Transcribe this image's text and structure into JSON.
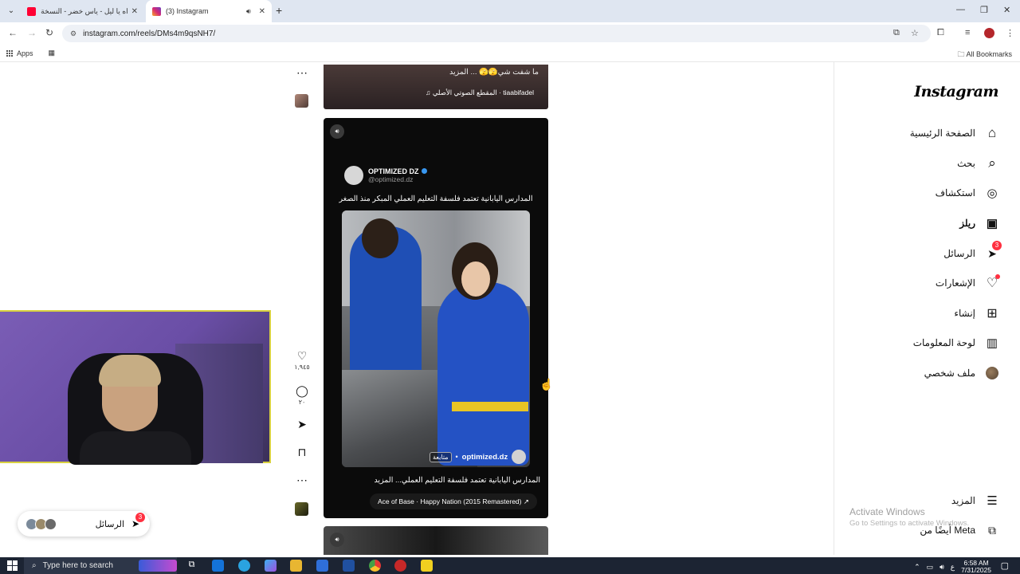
{
  "browser": {
    "tabs": [
      {
        "title": "اه يا ليل - ياس خضر - النسخة الأ",
        "active": false,
        "favicon_color": "#ff0033"
      },
      {
        "title": "(3) Instagram",
        "active": true,
        "favicon_color": "#d62976"
      }
    ],
    "url": "instagram.com/reels/DMs4m9qsNH7/",
    "bookmarks": {
      "apps": "Apps",
      "all": "All Bookmarks"
    }
  },
  "sidebar": {
    "logo": "Instagram",
    "items": [
      {
        "label": "الصفحة الرئيسية",
        "icon": "home-icon",
        "glyph": "⌂"
      },
      {
        "label": "بحث",
        "icon": "search-icon",
        "glyph": "⌕"
      },
      {
        "label": "استكشاف",
        "icon": "compass-icon",
        "glyph": "◎"
      },
      {
        "label": "ريلز",
        "icon": "reels-icon",
        "glyph": "▣"
      },
      {
        "label": "الرسائل",
        "icon": "messenger-icon",
        "glyph": "➤",
        "badge": "3"
      },
      {
        "label": "الإشعارات",
        "icon": "heart-icon",
        "glyph": "♡"
      },
      {
        "label": "إنشاء",
        "icon": "create-icon",
        "glyph": "⊞"
      },
      {
        "label": "لوحة المعلومات",
        "icon": "dashboard-icon",
        "glyph": "▥"
      },
      {
        "label": "ملف شخصي",
        "icon": "profile-avatar",
        "glyph": ""
      }
    ],
    "more": "المزيد",
    "meta": "أيضًا من Meta"
  },
  "previous_reel": {
    "caption": "ما شفت شي🫣🫣 ... المزيد",
    "audio": "♫ المقطع الصوتي الأصلي · tiaabifadel"
  },
  "reel": {
    "post_name": "OPTIMIZED DZ",
    "post_handle": "@optimized.dz",
    "post_text": "المدارس اليابانية تعتمد فلسفة التعليم العملي المبكر منذ الصغر",
    "username": "optimized.dz",
    "follow": "متابعة",
    "caption": "المدارس اليابانية تعتمد فلسفة التعليم العملي... المزيد",
    "audio": "Ace of Base · Happy Nation (2015 Remastered) ↗",
    "likes": "١,٩٤٥",
    "comments": "٢٠"
  },
  "messages_pill": {
    "label": "الرسائل",
    "badge": "3"
  },
  "watermark": {
    "line1": "Activate Windows",
    "line2": "Go to Settings to activate Windows."
  },
  "taskbar": {
    "search_placeholder": "Type here to search",
    "time": "6:58 AM",
    "date": "7/31/2025",
    "lang": "ع"
  }
}
